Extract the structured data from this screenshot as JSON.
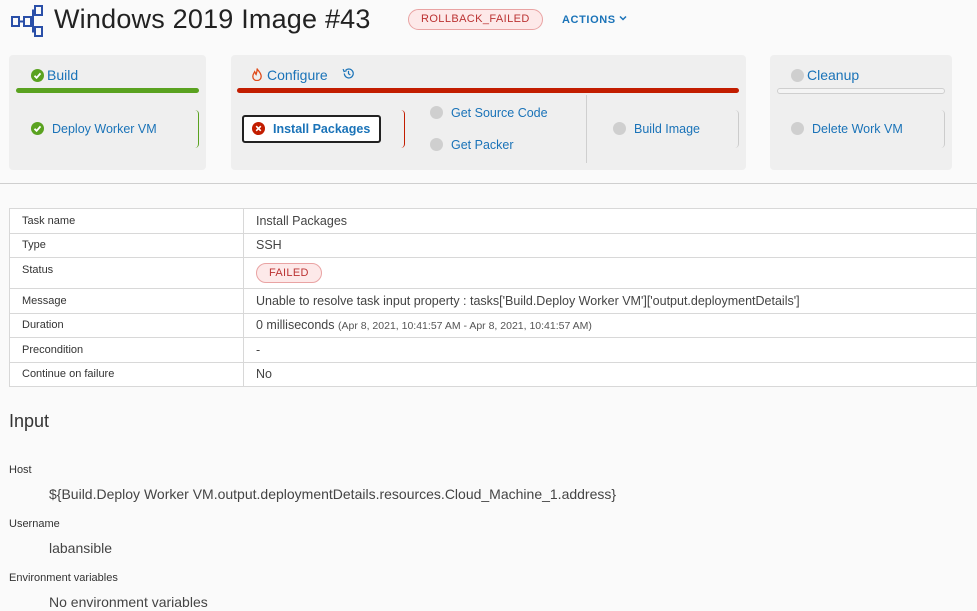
{
  "header": {
    "title": "Windows 2019 Image #43",
    "status": "ROLLBACK_FAILED",
    "actions_label": "ACTIONS",
    "icon": "pipeline-icon"
  },
  "stages": {
    "build": {
      "title": "Build",
      "status_color": "#5aa220",
      "tasks": [
        {
          "label": "Deploy Worker VM",
          "status": "completed"
        }
      ]
    },
    "configure": {
      "title": "Configure",
      "status_color": "#c21d00",
      "tasks": [
        {
          "label": "Install Packages",
          "status": "failed"
        },
        {
          "label": "Get Source Code",
          "status": "not-started"
        },
        {
          "label": "Get Packer",
          "status": "not-started"
        },
        {
          "label": "Build Image",
          "status": "not-started"
        }
      ]
    },
    "cleanup": {
      "title": "Cleanup",
      "tasks": [
        {
          "label": "Delete Work VM",
          "status": "not-started"
        }
      ]
    }
  },
  "details": {
    "rows": [
      {
        "key": "Task name",
        "value": "Install Packages"
      },
      {
        "key": "Type",
        "value": "SSH"
      },
      {
        "key": "Status",
        "value": "FAILED"
      },
      {
        "key": "Message",
        "value": "Unable to resolve task input property : tasks['Build.Deploy Worker VM']['output.deploymentDetails']"
      },
      {
        "key": "Duration",
        "value": "0 milliseconds",
        "extra": "(Apr 8, 2021, 10:41:57 AM - Apr 8, 2021, 10:41:57 AM)"
      },
      {
        "key": "Precondition",
        "value": "-"
      },
      {
        "key": "Continue on failure",
        "value": "No"
      }
    ]
  },
  "input": {
    "heading": "Input",
    "fields": [
      {
        "label": "Host",
        "value": "${Build.Deploy Worker VM.output.deploymentDetails.resources.Cloud_Machine_1.address}"
      },
      {
        "label": "Username",
        "value": "labansible"
      },
      {
        "label": "Environment variables",
        "value": "No environment variables"
      }
    ]
  },
  "colors": {
    "accent": "#1a73b8",
    "success": "#5aa220",
    "error": "#c21d00",
    "pending": "#cfcfcf"
  }
}
